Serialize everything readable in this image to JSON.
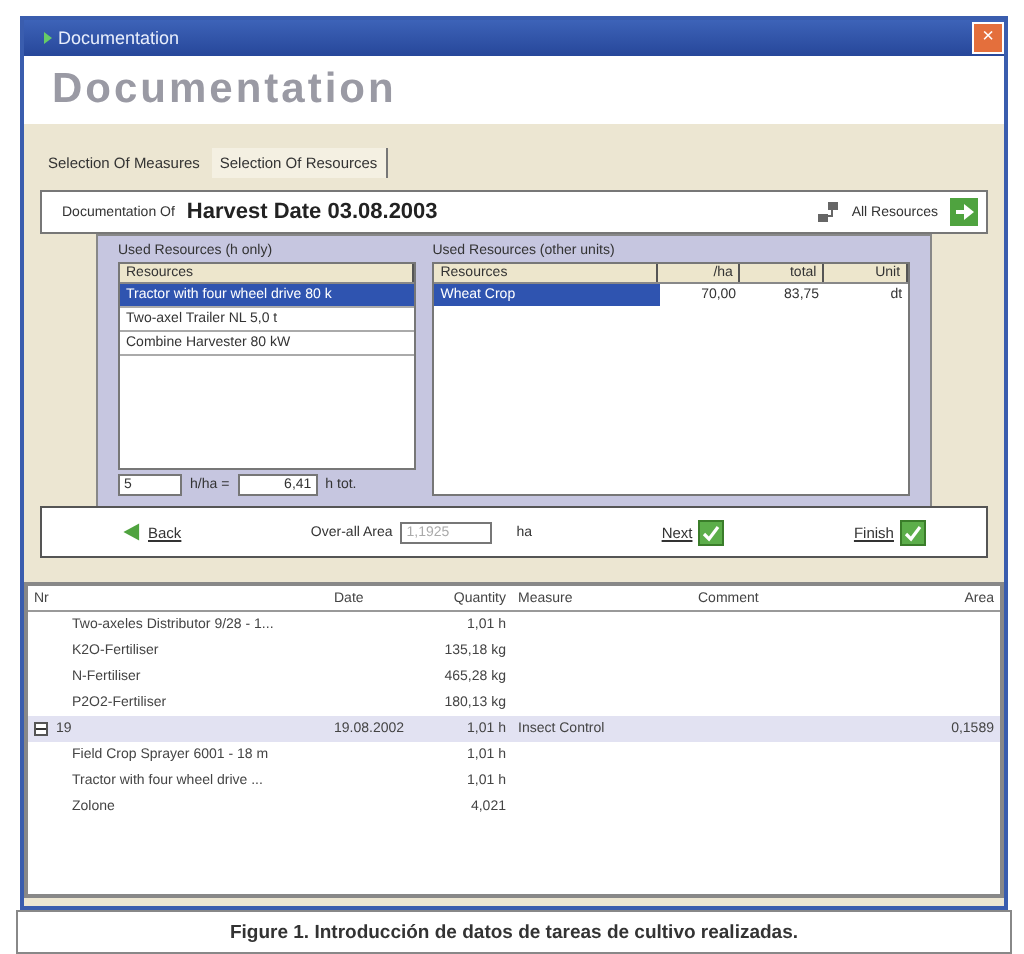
{
  "window": {
    "title": "Documentation",
    "close": "×"
  },
  "header": "Documentation",
  "tabs": [
    {
      "label": "Selection Of Measures",
      "selected": false
    },
    {
      "label": "Selection Of Resources",
      "selected": true
    }
  ],
  "documentation_of": {
    "label": "Documentation Of",
    "value": "Harvest Date 03.08.2003",
    "all_resources": "All Resources"
  },
  "used_hours": {
    "title": "Used Resources (h only)",
    "column": "Resources",
    "items": [
      {
        "label": "Tractor with four wheel drive 80 k",
        "selected": true
      },
      {
        "label": "Two-axel Trailer NL 5,0 t",
        "selected": false
      },
      {
        "label": "Combine Harvester 80 kW",
        "selected": false
      }
    ],
    "hours_per_ha": "5",
    "per_ha_unit": "h/ha =",
    "total": "6,41",
    "total_unit": "h tot."
  },
  "used_other": {
    "title": "Used Resources (other units)",
    "columns": [
      "Resources",
      "/ha",
      "total",
      "Unit"
    ],
    "rows": [
      {
        "cells": [
          "Wheat Crop",
          "70,00",
          "83,75",
          "dt"
        ],
        "selected": true
      }
    ]
  },
  "nav": {
    "back": "Back",
    "area_label": "Over-all Area",
    "area_value": "1,1925",
    "area_unit": "ha",
    "next": "Next",
    "next_checked": true,
    "finish": "Finish",
    "finish_checked": true
  },
  "table": {
    "columns": [
      "Nr",
      "Date",
      "Quantity",
      "Measure",
      "Comment",
      "Area"
    ],
    "rows": [
      {
        "kind": "resource",
        "nr": "Two-axeles Distributor 9/28 - 1...",
        "quantity": "1,01 h"
      },
      {
        "kind": "resource",
        "nr": "K2O-Fertiliser",
        "quantity": "135,18 kg"
      },
      {
        "kind": "resource",
        "nr": "N-Fertiliser",
        "quantity": "465,28 kg"
      },
      {
        "kind": "resource",
        "nr": "P2O2-Fertiliser",
        "quantity": "180,13 kg"
      },
      {
        "kind": "measure",
        "nr": "19",
        "date": "19.08.2002",
        "quantity": "1,01 h",
        "measure": "Insect Control",
        "area": "0,1589",
        "expanded": true,
        "children": [
          {
            "kind": "resource",
            "nr": "Field Crop Sprayer 6001 - 18 m",
            "quantity": "1,01 h"
          },
          {
            "kind": "resource",
            "nr": "Tractor with four wheel drive ...",
            "quantity": "1,01 h"
          },
          {
            "kind": "resource",
            "nr": "Zolone",
            "quantity": "4,021"
          }
        ]
      }
    ]
  },
  "caption": "Figure 1. Introducción de datos de tareas de cultivo realizadas."
}
